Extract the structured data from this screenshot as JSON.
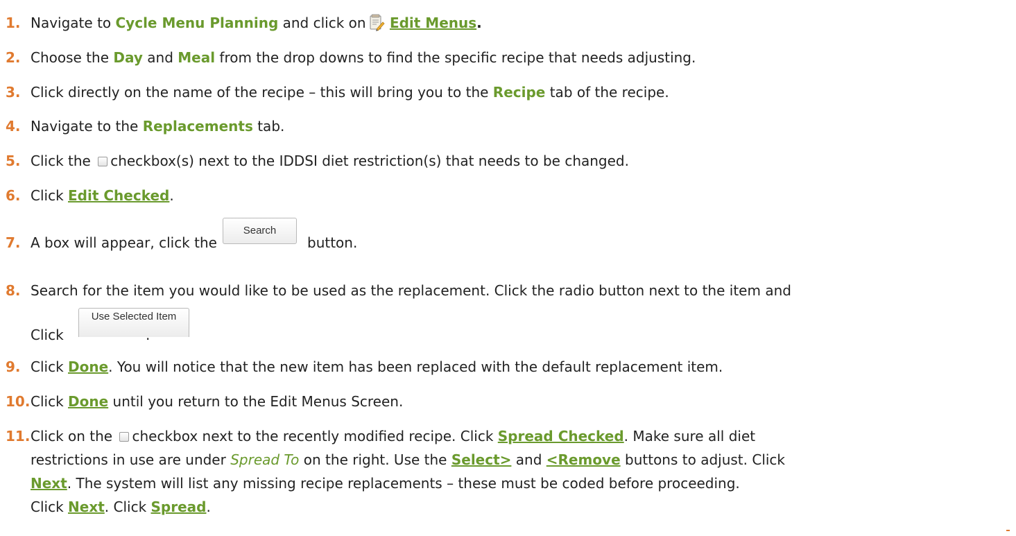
{
  "steps": {
    "s1": {
      "num": "1.",
      "a": "Navigate to ",
      "b": "Cycle Menu Planning",
      "c": " and click on",
      "d": "Edit Menus",
      "e": "."
    },
    "s2": {
      "num": "2.",
      "a": "Choose the ",
      "b": "Day",
      "c": " and ",
      "d": "Meal",
      "e": " from the drop downs to find the specific recipe that needs adjusting."
    },
    "s3": {
      "num": "3.",
      "a": "Click directly on the name of the recipe – this will bring you to the ",
      "b": "Recipe",
      "c": " tab of the recipe."
    },
    "s4": {
      "num": "4.",
      "a": "Navigate to the ",
      "b": "Replacements",
      "c": " tab."
    },
    "s5": {
      "num": "5.",
      "a": "Click the ",
      "b": "checkbox(s) next to the IDDSI diet restriction(s) that needs to be changed."
    },
    "s6": {
      "num": "6.",
      "a": "Click ",
      "b": "Edit Checked",
      "c": "."
    },
    "s7": {
      "num": "7.",
      "a": "A box will appear, click the",
      "b": "button.",
      "btn": "Search"
    },
    "s8": {
      "num": "8.",
      "a": "Search for the item you would like to be used as the replacement. Click the radio button next to the item and",
      "b": "Click",
      "c": ".",
      "btn": "Use Selected Item"
    },
    "s9": {
      "num": "9.",
      "a": "Click ",
      "b": "Done",
      "c": ". You will notice that the new item has been replaced with the default replacement item."
    },
    "s10": {
      "num": "10.",
      "a": "Click ",
      "b": "Done",
      "c": " until you return to the Edit Menus Screen."
    },
    "s11": {
      "num": "11.",
      "a": "Click on the ",
      "b": "checkbox next to the recently modified recipe. Click ",
      "c": "Spread Checked",
      "d": ". Make sure all diet",
      "e": "restrictions in use are under ",
      "f": "Spread To",
      "g": " on the right. Use the ",
      "h": "Select>",
      "i": " and ",
      "j": "<Remove",
      "k": " buttons to adjust. Click",
      "l": "Next",
      "m": ". The system will list any missing recipe replacements – these must be coded before proceeding.",
      "n": "Click ",
      "o": "Next",
      "p": ". Click ",
      "q": "Spread",
      "r": "."
    }
  },
  "icons": {
    "edit_menus": "edit-menus-icon",
    "checkbox": "checkbox-icon"
  },
  "colors": {
    "number": "#e07a2f",
    "highlight": "#6a9a2d",
    "text": "#222222"
  }
}
